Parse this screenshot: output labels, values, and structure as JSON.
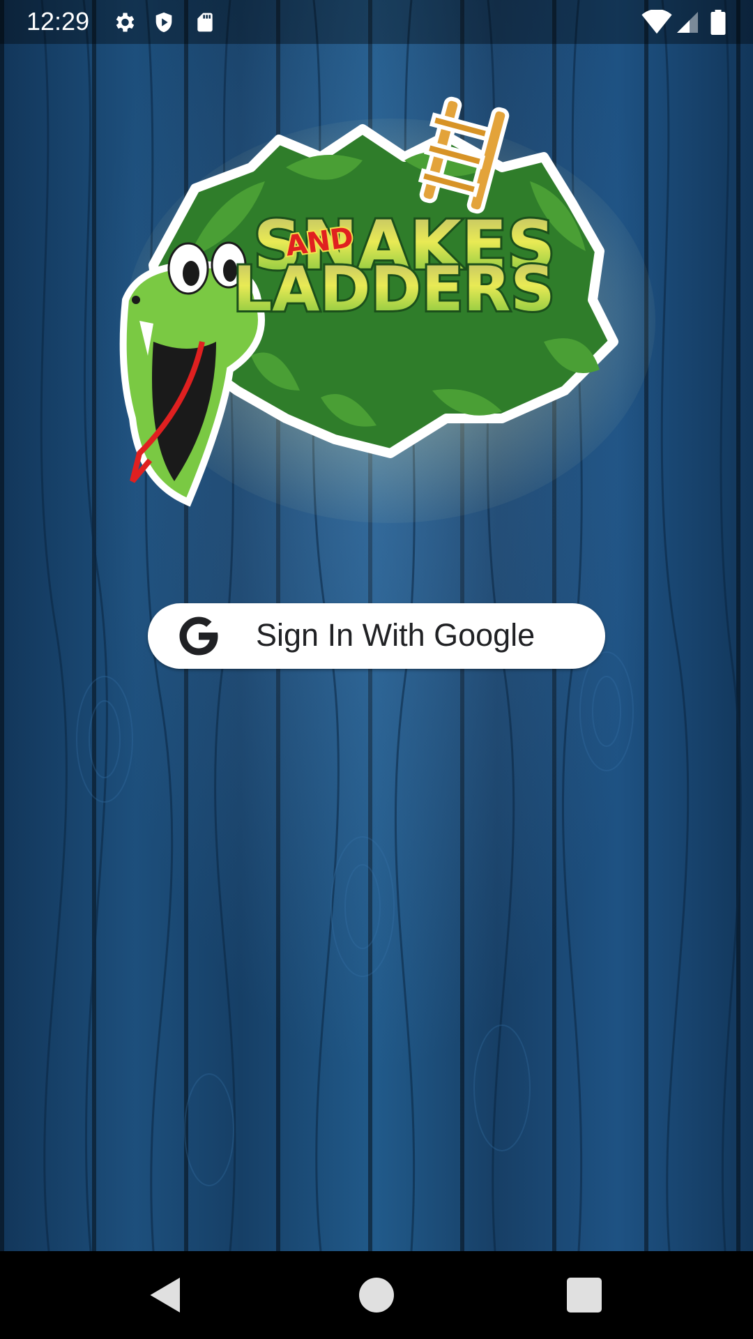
{
  "status_bar": {
    "time": "12:29",
    "left_icons": [
      "settings-icon",
      "shield-icon",
      "sd-card-icon"
    ],
    "right_icons": [
      "wifi-icon",
      "cell-signal-icon",
      "battery-icon"
    ]
  },
  "logo": {
    "line1": "SNAKES",
    "line2": "AND",
    "line3": "LADDERS"
  },
  "signin": {
    "label": "Sign In With Google",
    "icon": "google-g-icon"
  },
  "nav_bar": {
    "buttons": [
      "back-icon",
      "home-icon",
      "recents-icon"
    ]
  },
  "colors": {
    "background": "#1b4a75",
    "button_bg": "#ffffff",
    "button_text": "#202124",
    "logo_green": "#7ac943",
    "logo_yellow": "#f2e14c",
    "snake_tongue": "#e02020"
  }
}
